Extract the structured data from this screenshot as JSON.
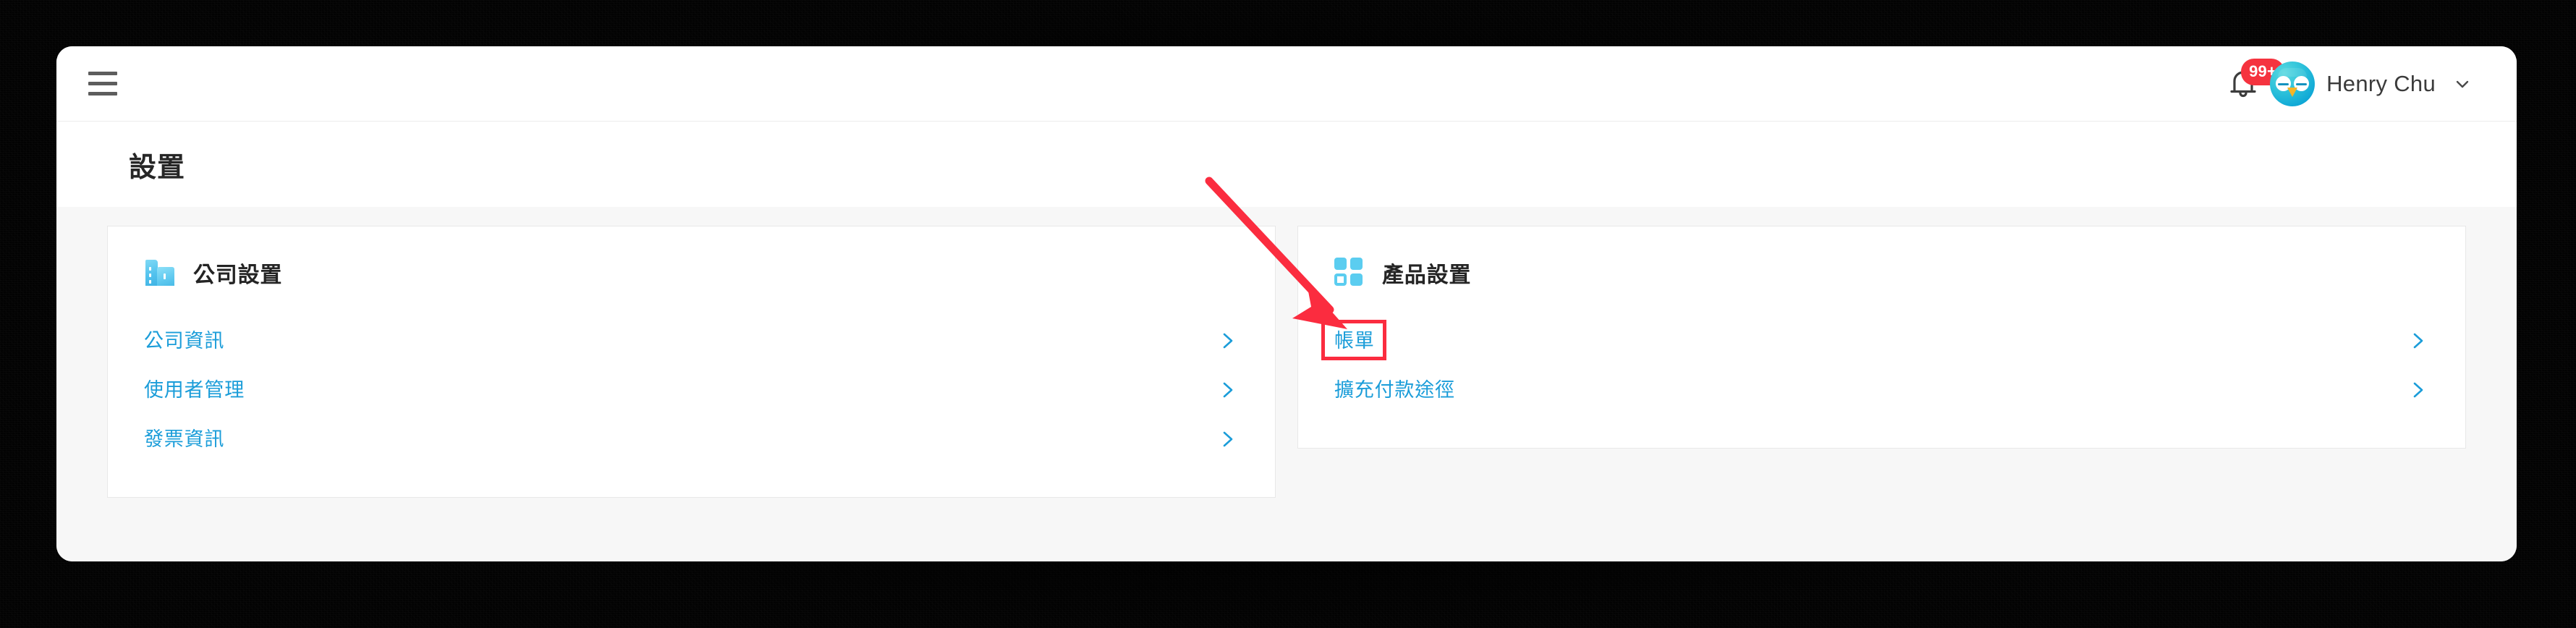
{
  "window": {
    "topbar": {
      "menu_button": "hamburger-menu",
      "notification_badge": "99+",
      "bell_icon": "bell-icon",
      "avatar_icon": "owl-avatar",
      "user_name": "Henry Chu",
      "caret_icon": "chevron-down-icon"
    },
    "page_title": "設置"
  },
  "cards": [
    {
      "icon": "building-icon",
      "title": "公司設置",
      "rows": [
        {
          "label": "公司資訊",
          "chevron": "chevron-right-icon",
          "highlighted": false
        },
        {
          "label": "使用者管理",
          "chevron": "chevron-right-icon",
          "highlighted": false
        },
        {
          "label": "發票資訊",
          "chevron": "chevron-right-icon",
          "highlighted": false
        }
      ]
    },
    {
      "icon": "grid-icon",
      "title": "產品設置",
      "rows": [
        {
          "label": "帳單",
          "chevron": "chevron-right-icon",
          "highlighted": true
        },
        {
          "label": "擴充付款途徑",
          "chevron": "chevron-right-icon",
          "highlighted": false
        }
      ]
    }
  ],
  "annotations": {
    "arrow": "red-arrow-pointing-to-billing",
    "highlight_box": "red-rectangle-around-billing",
    "color": "#fb2c3f"
  },
  "colors": {
    "link_blue": "#1b9dd9",
    "icon_cyan": "#5bcdf0",
    "badge_red": "#f5333f",
    "annotation_red": "#fb2c3f",
    "page_bg": "#f7f7f7",
    "card_border": "#e8e8e8"
  }
}
